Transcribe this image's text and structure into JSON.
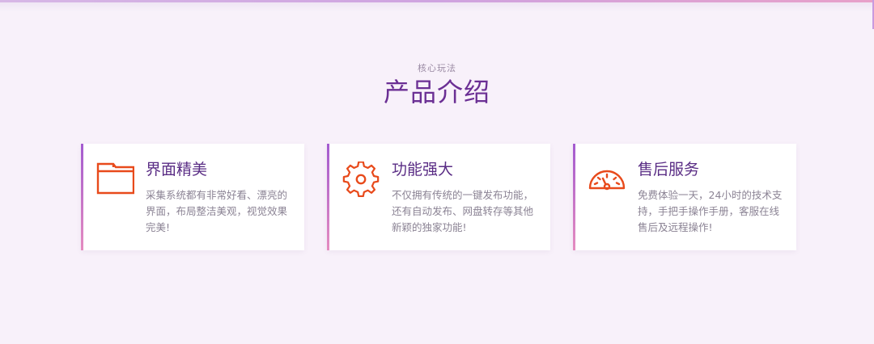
{
  "section": {
    "eyebrow": "核心玩法",
    "title": "产品介绍"
  },
  "colors": {
    "accent": "#6b2f94",
    "icon": "#e84a1b",
    "border_gradient_top": "#a35bd0",
    "border_gradient_bottom": "#e58cc0",
    "background": "#f8f1fa"
  },
  "features": [
    {
      "icon": "folder-icon",
      "title": "界面精美",
      "description": "采集系统都有非常好看、漂亮的界面，布局整洁美观，视觉效果完美!"
    },
    {
      "icon": "gear-icon",
      "title": "功能强大",
      "description": "不仅拥有传统的一键发布功能，还有自动发布、网盘转存等其他新颖的独家功能!"
    },
    {
      "icon": "speedometer-icon",
      "title": "售后服务",
      "description": "免费体验一天，24小时的技术支持，手把手操作手册，客服在线售后及远程操作!"
    }
  ]
}
